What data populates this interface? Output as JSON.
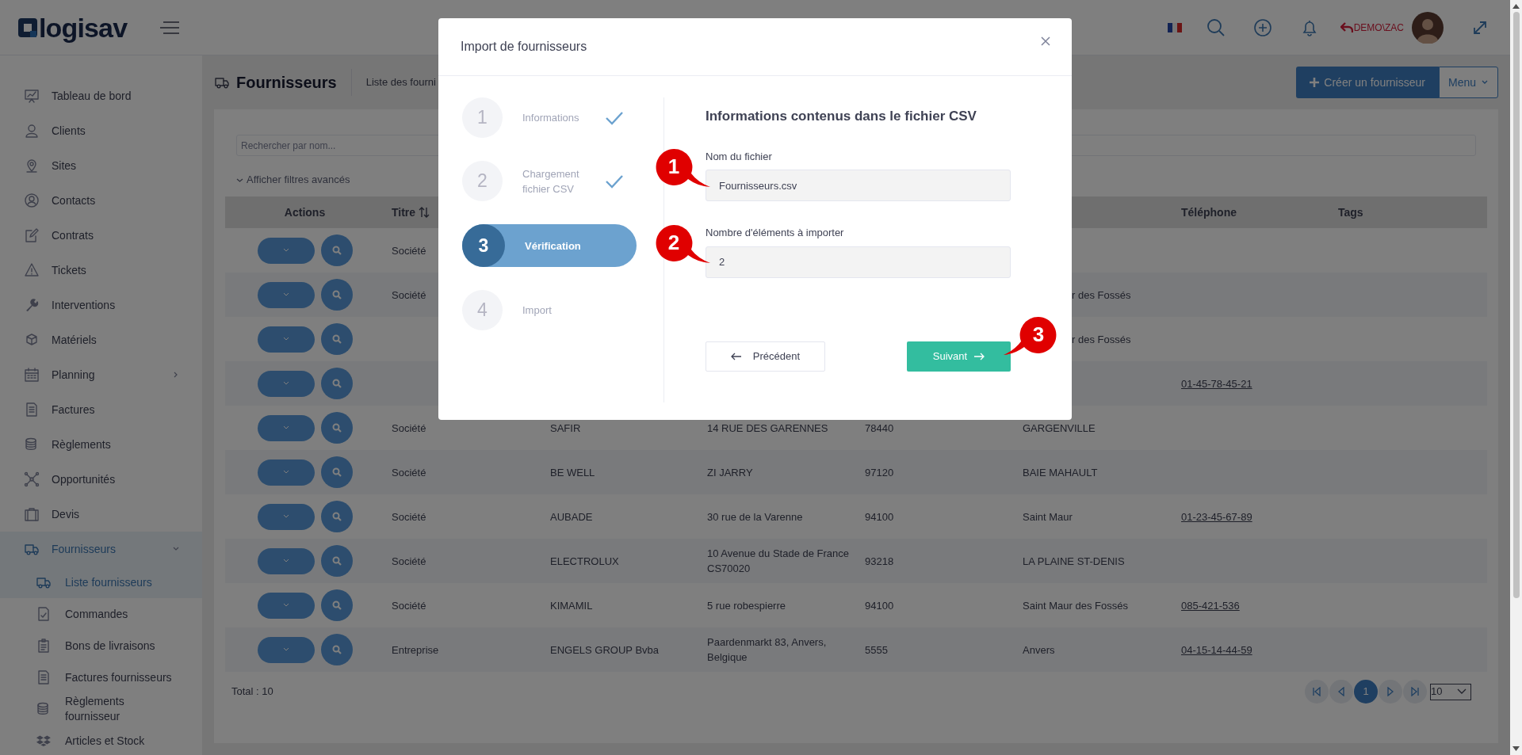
{
  "topbar": {
    "logo_text": "logisav",
    "user": "DEMO\\ZAC"
  },
  "sidebar": {
    "items": [
      {
        "label": "Tableau de bord",
        "kind": "link",
        "selected": false
      },
      {
        "label": "Clients",
        "kind": "link",
        "selected": false
      },
      {
        "label": "Sites",
        "kind": "link",
        "selected": false
      },
      {
        "label": "Contacts",
        "kind": "link",
        "selected": false
      },
      {
        "label": "Contrats",
        "kind": "link",
        "selected": false
      },
      {
        "label": "Tickets",
        "kind": "link",
        "selected": false
      },
      {
        "label": "Interventions",
        "kind": "link",
        "selected": false
      },
      {
        "label": "Matériels",
        "kind": "link",
        "selected": false
      },
      {
        "label": "Planning",
        "kind": "group",
        "expanded": false,
        "selected": false
      },
      {
        "label": "Factures",
        "kind": "link",
        "selected": false
      },
      {
        "label": "Règlements",
        "kind": "link",
        "selected": false
      },
      {
        "label": "Opportunités",
        "kind": "link",
        "selected": false
      },
      {
        "label": "Devis",
        "kind": "link",
        "selected": false
      },
      {
        "label": "Fournisseurs",
        "kind": "group",
        "expanded": true,
        "selected": true,
        "children": [
          {
            "label": "Liste fournisseurs",
            "selected": true
          },
          {
            "label": "Commandes",
            "selected": false
          },
          {
            "label": "Bons de livraisons",
            "selected": false
          },
          {
            "label": "Factures fournisseurs",
            "selected": false
          },
          {
            "label": "Règlements fournisseur",
            "selected": false
          },
          {
            "label": "Articles et Stock",
            "selected": false
          }
        ]
      }
    ]
  },
  "page_header": {
    "title": "Fournisseurs",
    "breadcrumb": "Liste des fourni",
    "create_button": "Créer un fournisseur",
    "menu_button": "Menu"
  },
  "filters": {
    "placeholder": "Rechercher par nom...",
    "advanced_toggle": "Afficher filtres avancés"
  },
  "table": {
    "columns": [
      {
        "label": "Actions",
        "sortable": false
      },
      {
        "label": "Titre",
        "sortable": true
      },
      {
        "label": "Téléphone",
        "sortable": false
      },
      {
        "label": "Tags",
        "sortable": false
      }
    ],
    "rows": [
      {
        "titre": "Société"
      },
      {
        "titre": "Société",
        "column_6": "r des Fossés",
        "column_6_cut": true
      },
      {
        "column_6": "r des Fossés",
        "column_6_cut": true
      },
      {
        "telephone": "01-45-78-45-21"
      },
      {
        "titre": "Société",
        "column_3": "SAFIR",
        "column_4": "14 RUE DES GARENNES",
        "column_5": "78440",
        "column_6": "GARGENVILLE"
      },
      {
        "titre": "Société",
        "column_3": "BE WELL",
        "column_4": "ZI JARRY",
        "column_5": "97120",
        "column_6": "BAIE MAHAULT"
      },
      {
        "titre": "Société",
        "column_3": "AUBADE",
        "column_4": "30 rue de la Varenne",
        "column_5": "94100",
        "column_6": "Saint Maur",
        "telephone": "01-23-45-67-89"
      },
      {
        "titre": "Société",
        "column_3": "ELECTROLUX",
        "column_4": "10 Avenue du Stade de France CS70020",
        "column_5": "93218",
        "column_6": "LA PLAINE ST-DENIS"
      },
      {
        "titre": "Société",
        "column_3": "KIMAMIL",
        "column_4": "5 rue robespierre",
        "column_5": "94100",
        "column_6": "Saint Maur des Fossés",
        "telephone": "085-421-536"
      },
      {
        "titre": "Entreprise",
        "column_3": "ENGELS GROUP Bvba",
        "column_4": "Paardenmarkt 83, Anvers, Belgique",
        "column_5": "5555",
        "column_6": "Anvers",
        "telephone": "04-15-14-44-59"
      }
    ],
    "total": "Total : 10"
  },
  "pagination": {
    "pages": [
      {
        "label": "1",
        "selected": true
      }
    ],
    "page_size": "10"
  },
  "dialog": {
    "title": "Import de fournisseurs",
    "steps": [
      {
        "number": "1",
        "label": "Informations",
        "done": true,
        "selected": false
      },
      {
        "number": "2",
        "label": "Chargement fichier CSV",
        "done": true,
        "selected": false
      },
      {
        "number": "3",
        "label": "Vérification",
        "done": false,
        "selected": true
      },
      {
        "number": "4",
        "label": "Import",
        "done": false,
        "selected": false
      }
    ],
    "heading": "Informations contenus dans le fichier CSV",
    "fields": [
      {
        "label": "Nom du fichier",
        "value": "Fournisseurs.csv"
      },
      {
        "label": "Nombre d'éléments à importer",
        "value": "2"
      }
    ],
    "back_button": "Précédent",
    "next_button": "Suivant"
  },
  "callouts": [
    {
      "label": "1"
    },
    {
      "label": "2"
    },
    {
      "label": "3"
    }
  ]
}
